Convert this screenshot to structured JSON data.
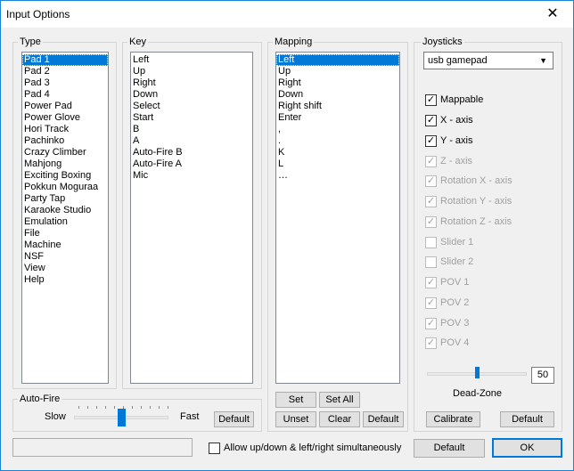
{
  "window": {
    "title": "Input Options",
    "close_glyph": "✕"
  },
  "type_group": {
    "label": "Type",
    "selected_index": 0,
    "items": [
      "Pad 1",
      "Pad 2",
      "Pad 3",
      "Pad 4",
      "Power Pad",
      "Power Glove",
      "Hori Track",
      "Pachinko",
      "Crazy Climber",
      "Mahjong",
      "Exciting Boxing",
      "Pokkun Moguraa",
      "Party Tap",
      "Karaoke Studio",
      "Emulation",
      "File",
      "Machine",
      "NSF",
      "View",
      "Help"
    ]
  },
  "key_group": {
    "label": "Key",
    "items": [
      "Left",
      "Up",
      "Right",
      "Down",
      "Select",
      "Start",
      "B",
      "A",
      "Auto-Fire B",
      "Auto-Fire A",
      "Mic"
    ]
  },
  "mapping_group": {
    "label": "Mapping",
    "selected_index": 0,
    "items": [
      "Left",
      "Up",
      "Right",
      "Down",
      "Right shift",
      "Enter",
      ",",
      ".",
      "K",
      "L",
      "…"
    ],
    "set_label": "Set",
    "set_all_label": "Set All",
    "unset_label": "Unset",
    "clear_label": "Clear",
    "default_label": "Default"
  },
  "joysticks_group": {
    "label": "Joysticks",
    "device": "usb gamepad",
    "options": [
      {
        "label": "Mappable",
        "checked": true,
        "enabled": true
      },
      {
        "label": "X - axis",
        "checked": true,
        "enabled": true
      },
      {
        "label": "Y - axis",
        "checked": true,
        "enabled": true
      },
      {
        "label": "Z - axis",
        "checked": true,
        "enabled": false
      },
      {
        "label": "Rotation X - axis",
        "checked": true,
        "enabled": false
      },
      {
        "label": "Rotation Y - axis",
        "checked": true,
        "enabled": false
      },
      {
        "label": "Rotation Z - axis",
        "checked": true,
        "enabled": false
      },
      {
        "label": "Slider 1",
        "checked": false,
        "enabled": false
      },
      {
        "label": "Slider 2",
        "checked": false,
        "enabled": false
      },
      {
        "label": "POV 1",
        "checked": true,
        "enabled": false
      },
      {
        "label": "POV 2",
        "checked": true,
        "enabled": false
      },
      {
        "label": "POV 3",
        "checked": true,
        "enabled": false
      },
      {
        "label": "POV 4",
        "checked": true,
        "enabled": false
      }
    ],
    "deadzone_value": "50",
    "deadzone_fraction": 0.5,
    "deadzone_label": "Dead-Zone",
    "calibrate_label": "Calibrate",
    "default_label": "Default"
  },
  "autofire_group": {
    "label": "Auto-Fire",
    "slow_label": "Slow",
    "fast_label": "Fast",
    "speed_fraction": 0.5,
    "default_label": "Default"
  },
  "footer": {
    "allow_label": "Allow up/down & left/right simultaneously",
    "allow_checked": false,
    "default_label": "Default",
    "ok_label": "OK"
  },
  "colors": {
    "selection": "#0078d7",
    "accent": "#0078d7"
  }
}
